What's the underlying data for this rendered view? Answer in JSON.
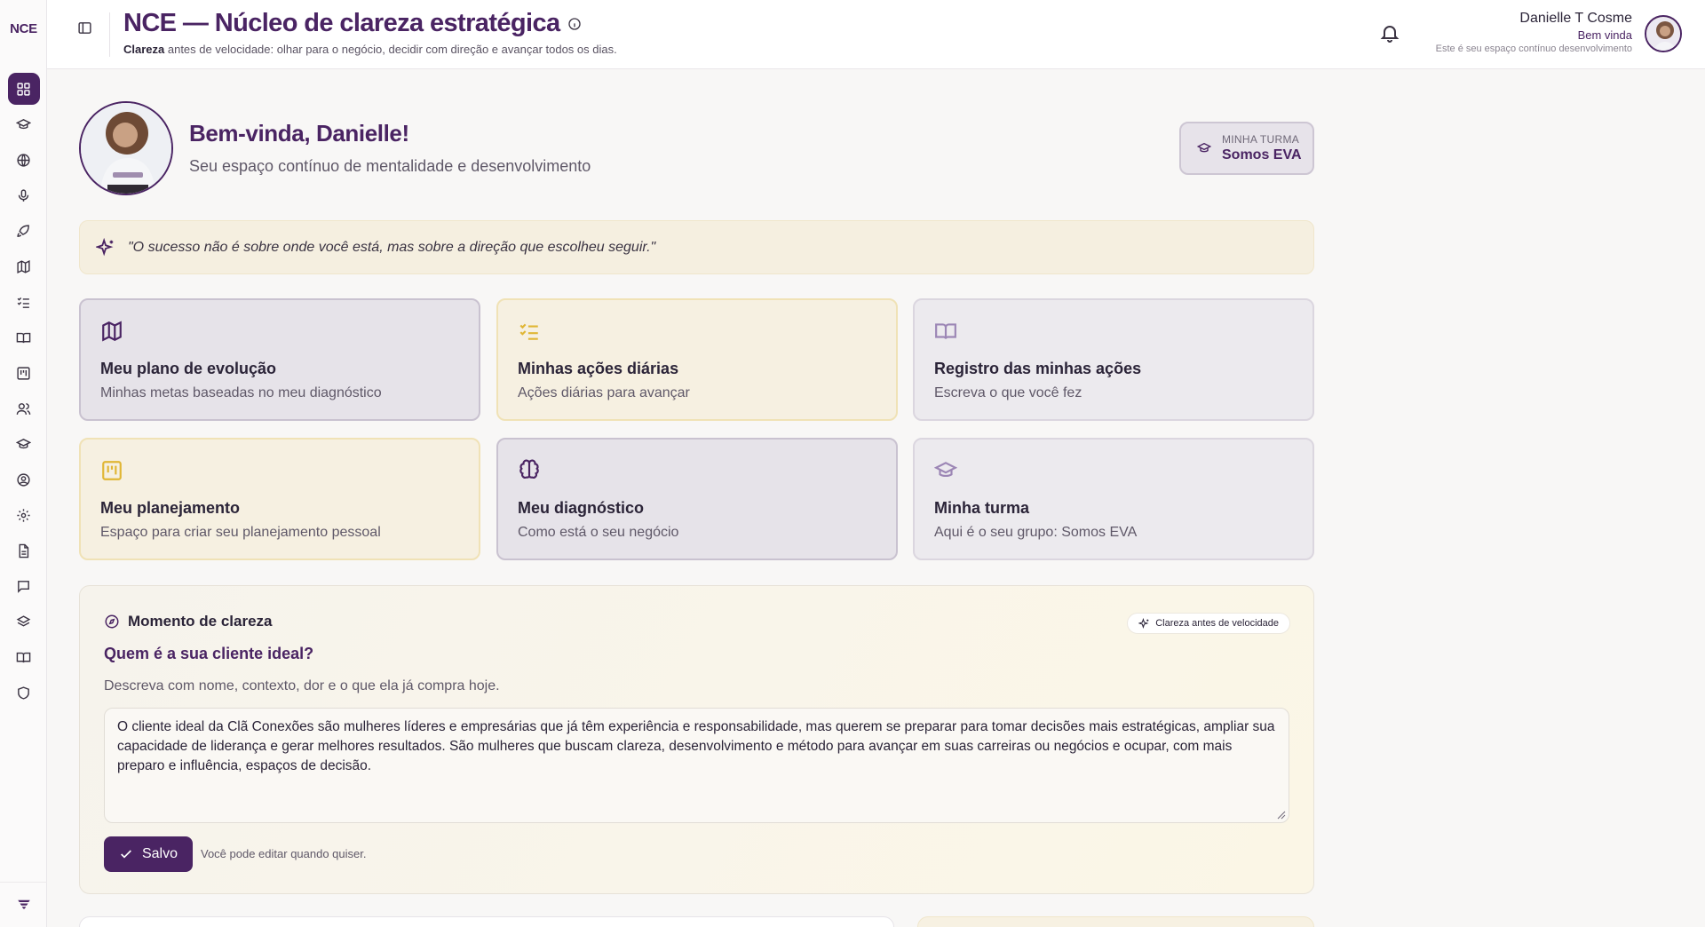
{
  "sidebar": {
    "logo": "NCE",
    "items": [
      {
        "icon": "dashboard-icon",
        "active": true
      },
      {
        "icon": "graduation-cap-icon"
      },
      {
        "icon": "globe-icon"
      },
      {
        "icon": "microphone-icon"
      },
      {
        "icon": "rocket-icon"
      },
      {
        "icon": "map-icon"
      },
      {
        "icon": "checklist-icon"
      },
      {
        "icon": "book-open-icon"
      },
      {
        "icon": "kanban-icon"
      },
      {
        "icon": "users-icon"
      },
      {
        "icon": "graduation-cap-icon"
      },
      {
        "icon": "user-circle-icon"
      },
      {
        "icon": "settings-icon"
      },
      {
        "icon": "document-icon"
      },
      {
        "icon": "chat-icon"
      },
      {
        "icon": "layers-icon"
      },
      {
        "icon": "book-icon"
      },
      {
        "icon": "shield-icon"
      }
    ],
    "bottom_icon": "brand-filter-icon"
  },
  "header": {
    "title": "NCE — Núcleo de clareza estratégica",
    "subtitle_bold": "Clareza",
    "subtitle_rest": " antes de velocidade: olhar para o negócio, decidir com direção e avançar todos os dias.",
    "user": {
      "name": "Danielle T Cosme",
      "greeting": "Bem vinda",
      "tagline": "Este é seu espaço contínuo desenvolvimento"
    }
  },
  "welcome": {
    "title": "Bem-vinda, Danielle!",
    "subtitle": "Seu espaço contínuo de mentalidade e desenvolvimento",
    "turma_caption": "MINHA TURMA",
    "turma_name": "Somos EVA"
  },
  "quote": "\"O sucesso não é sobre onde você está, mas sobre a direção que escolheu seguir.\"",
  "cards": [
    {
      "title": "Meu plano de evolução",
      "subtitle": "Minhas metas baseadas no meu diagnóstico",
      "icon": "map-icon",
      "style": "purple"
    },
    {
      "title": "Minhas ações diárias",
      "subtitle": "Ações diárias para avançar",
      "icon": "checklist-icon",
      "style": "yellow"
    },
    {
      "title": "Registro das minhas ações",
      "subtitle": "Escreva o que você fez",
      "icon": "book-open-icon",
      "style": "grey"
    },
    {
      "title": "Meu planejamento",
      "subtitle": "Espaço para criar seu planejamento pessoal",
      "icon": "kanban-icon",
      "style": "yellow"
    },
    {
      "title": "Meu diagnóstico",
      "subtitle": "Como está o seu negócio",
      "icon": "brain-icon",
      "style": "purple"
    },
    {
      "title": "Minha turma",
      "subtitle": "Aqui é o seu grupo: Somos EVA",
      "icon": "graduation-cap-icon",
      "style": "grey"
    }
  ],
  "moment": {
    "title": "Momento de clareza",
    "chip": "Clareza antes de velocidade",
    "question": "Quem é a sua cliente ideal?",
    "description": "Descreva com nome, contexto, dor e o que ela já compra hoje.",
    "answer": "O cliente ideal da Clã Conexões são mulheres líderes e empresárias que já têm experiência e responsabilidade, mas querem se preparar para tomar decisões mais estratégicas, ampliar sua capacidade de liderança e gerar melhores resultados. São mulheres que buscam clareza, desenvolvimento e método para avançar em suas carreiras ou negócios e ocupar, com mais preparo e influência, espaços de decisão.",
    "save_label": "Salvo",
    "save_note": "Você pode editar quando quiser."
  },
  "colors": {
    "brand": "#4a2463",
    "accent_yellow": "#e0b634",
    "quote_bg": "#f5efe0"
  }
}
